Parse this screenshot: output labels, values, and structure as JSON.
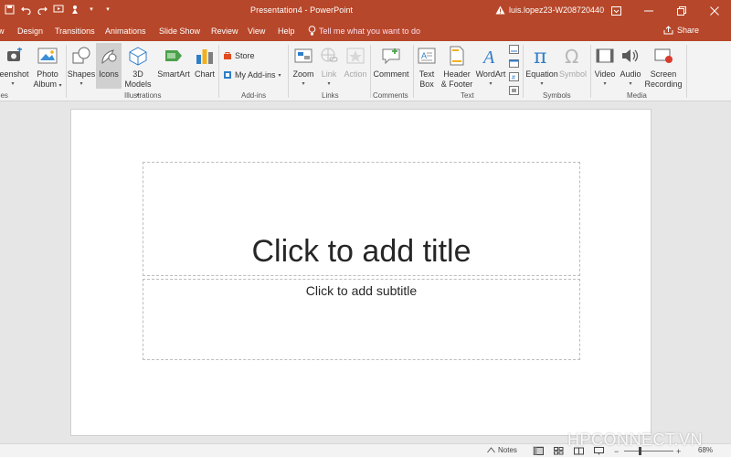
{
  "titlebar": {
    "doc_title": "Presentation4  -  PowerPoint",
    "user": "luis.lopez23-W208720440",
    "colors": {
      "accent": "#b7472a"
    }
  },
  "tabs": [
    "w",
    "Design",
    "Transitions",
    "Animations",
    "Slide Show",
    "Review",
    "View",
    "Help"
  ],
  "tell_me": "Tell me what you want to do",
  "share": "Share",
  "ribbon": {
    "screenshot": "reenshot",
    "photo_album": [
      "Photo",
      "Album"
    ],
    "shapes": "Shapes",
    "icons": "Icons",
    "models_3d": [
      "3D",
      "Models"
    ],
    "smartart": "SmartArt",
    "chart": "Chart",
    "store": "Store",
    "my_addins": "My Add-ins",
    "zoom": "Zoom",
    "link": "Link",
    "action": "Action",
    "comment": "Comment",
    "text_box": [
      "Text",
      "Box"
    ],
    "header_footer": [
      "Header",
      "& Footer"
    ],
    "wordart": "WordArt",
    "equation": "Equation",
    "symbol": "Symbol",
    "video": "Video",
    "audio": "Audio",
    "screen_recording": [
      "Screen",
      "Recording"
    ],
    "groups": {
      "images": "ges",
      "illustrations": "Illustrations",
      "addins": "Add-ins",
      "links": "Links",
      "comments": "Comments",
      "text": "Text",
      "symbols": "Symbols",
      "media": "Media"
    }
  },
  "slide": {
    "title_placeholder": "Click to add title",
    "subtitle_placeholder": "Click to add subtitle"
  },
  "statusbar": {
    "notes": "Notes",
    "zoom": "68%",
    "zoom_value": 68
  },
  "watermark": "HPCONNECT.VN"
}
